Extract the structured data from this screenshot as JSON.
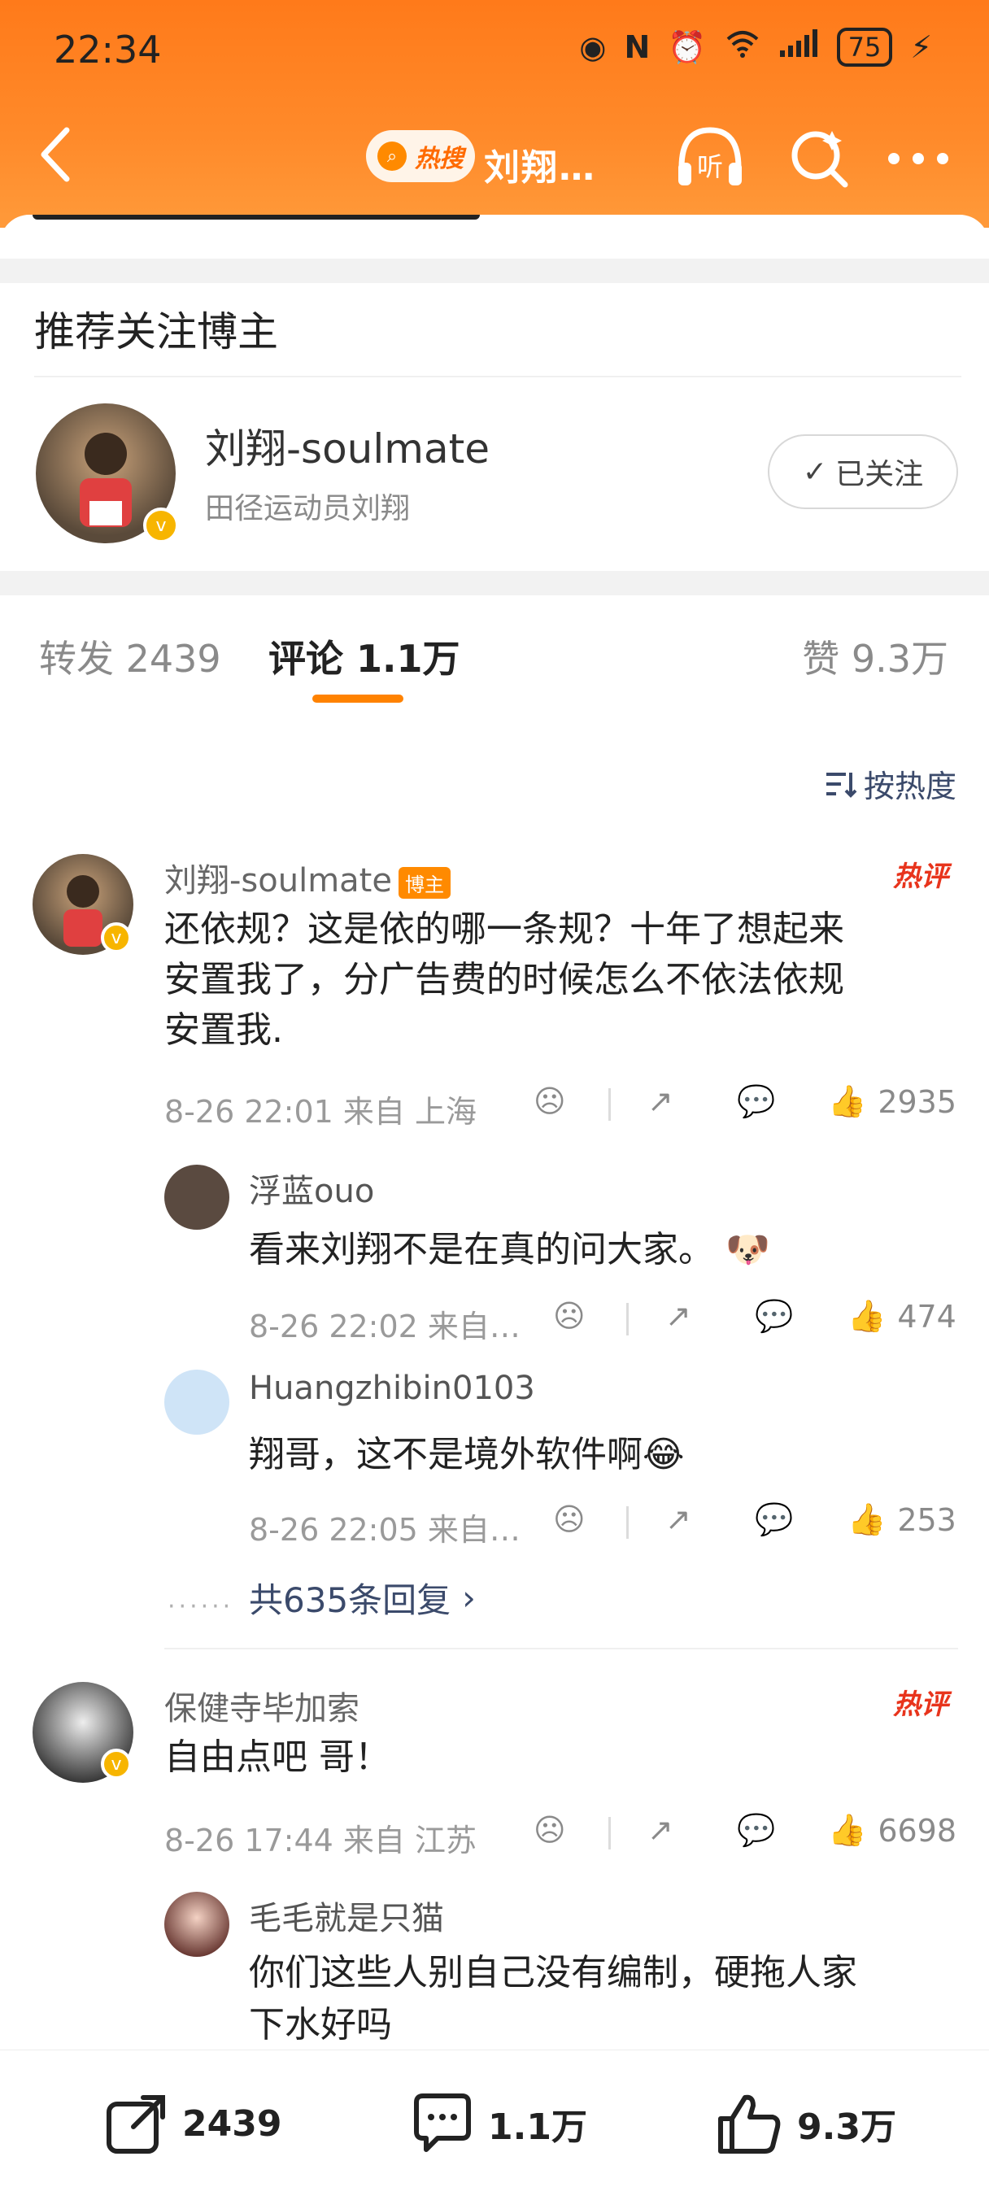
{
  "status_bar": {
    "time": "22:34",
    "battery": "75"
  },
  "header": {
    "hot_label": "热搜",
    "title_partial": "刘翔…",
    "listen_label": "听"
  },
  "recommend": {
    "section_title": "推荐关注博主",
    "name": "刘翔-soulmate",
    "desc": "田径运动员刘翔",
    "follow_label": "已关注"
  },
  "tabs": {
    "repost": "转发 2439",
    "comment": "评论 1.1万",
    "like": "赞 9.3万"
  },
  "sort_label": "按热度",
  "comments": [
    {
      "name": "刘翔-soulmate",
      "badge": "博主",
      "hot_tag": "热评",
      "text_lines": [
        "还依规？这是依的哪一条规？十年了想起来",
        "安置我了，分广告费的时候怎么不依法依规",
        "安置我."
      ],
      "meta": "8-26 22:01 来自 上海",
      "likes": "2935",
      "replies": [
        {
          "name": "浮蓝ouo",
          "text": "看来刘翔不是在真的问大家。",
          "meta": "8-26 22:02 来自…",
          "likes": "474"
        },
        {
          "name": "Huangzhibin0103",
          "text": "翔哥，这不是境外软件啊",
          "meta": "8-26 22:05 来自…",
          "likes": "253"
        }
      ],
      "more_replies": "共635条回复"
    },
    {
      "name": "保健寺毕加索",
      "hot_tag": "热评",
      "text": "自由点吧 哥！",
      "meta": "8-26 17:44 来自 江苏",
      "likes": "6698",
      "replies": [
        {
          "name": "毛毛就是只猫",
          "text_lines": [
            "你们这些人别自己没有编制，硬拖人家",
            "下水好吗"
          ]
        }
      ]
    }
  ],
  "bottom_bar": {
    "repost": "2439",
    "comment": "1.1万",
    "like": "9.3万"
  },
  "colors": {
    "accent": "#ff8200",
    "header": "#ff7a1a",
    "hot": "#e8341c",
    "badge": "#ff8a00"
  }
}
